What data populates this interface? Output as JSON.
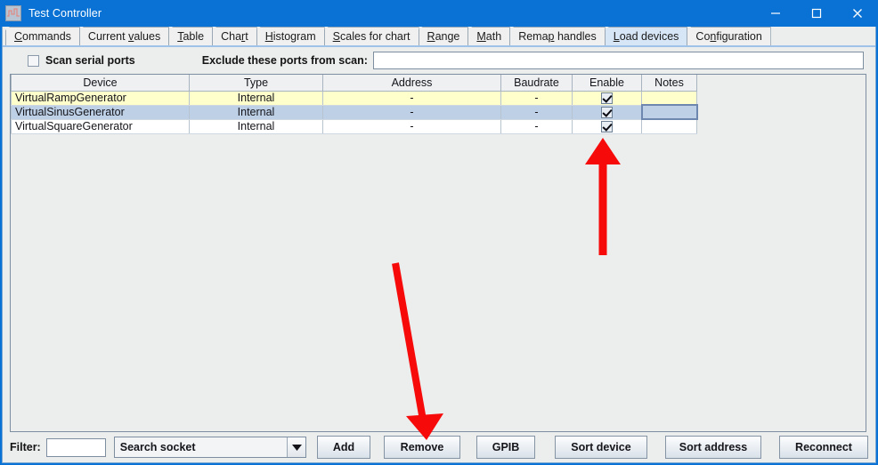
{
  "window": {
    "title": "Test Controller",
    "icon": "chart-waveform-icon",
    "minimize_label": "—",
    "maximize_label": "□",
    "close_label": "✕",
    "titlebar_color": "#0a72d4"
  },
  "tabs": [
    {
      "label": "Commands",
      "mnemonic_index": 0,
      "selected": false
    },
    {
      "label": "Current values",
      "mnemonic_index": 8,
      "selected": false
    },
    {
      "label": "Table",
      "mnemonic_index": 0,
      "selected": false
    },
    {
      "label": "Chart",
      "mnemonic_index": 3,
      "selected": false
    },
    {
      "label": "Histogram",
      "mnemonic_index": 0,
      "selected": false
    },
    {
      "label": "Scales for chart",
      "mnemonic_index": 0,
      "selected": false
    },
    {
      "label": "Range",
      "mnemonic_index": 0,
      "selected": false
    },
    {
      "label": "Math",
      "mnemonic_index": 0,
      "selected": false
    },
    {
      "label": "Remap handles",
      "mnemonic_index": 4,
      "selected": false
    },
    {
      "label": "Load devices",
      "mnemonic_index": 0,
      "selected": true
    },
    {
      "label": "Configuration",
      "mnemonic_index": 2,
      "selected": false
    }
  ],
  "options": {
    "scan_serial_ports_label": "Scan serial ports",
    "scan_serial_ports_checked": false,
    "exclude_label": "Exclude these ports from scan:",
    "exclude_value": "",
    "exclude_placeholder": ""
  },
  "table": {
    "columns": [
      "Device",
      "Type",
      "Address",
      "Baudrate",
      "Enable",
      "Notes"
    ],
    "rows": [
      {
        "device": "VirtualRampGenerator",
        "type": "Internal",
        "address": "-",
        "baudrate": "-",
        "enable": true,
        "notes": "",
        "state": "alternate"
      },
      {
        "device": "VirtualSinusGenerator",
        "type": "Internal",
        "address": "-",
        "baudrate": "-",
        "enable": true,
        "notes": "",
        "state": "selected"
      },
      {
        "device": "VirtualSquareGenerator",
        "type": "Internal",
        "address": "-",
        "baudrate": "-",
        "enable": true,
        "notes": "",
        "state": "normal"
      }
    ],
    "row_colors": {
      "alternate": "#ffffcc",
      "selected": "#bdd0e6",
      "normal": "#ffffff"
    }
  },
  "bottom": {
    "filter_label": "Filter:",
    "filter_value": "",
    "socket_selected": "Search socket",
    "socket_options": [
      "Search socket"
    ],
    "dropdown_icon": "chevron-down-icon",
    "buttons": {
      "add": "Add",
      "remove": "Remove",
      "gpib": "GPIB",
      "sort_device": "Sort device",
      "sort_address": "Sort address",
      "reconnect": "Reconnect"
    }
  },
  "annotations": {
    "color": "#f60a0a",
    "arrow_up_target": "enable-checkbox-row-3",
    "arrow_diagonal_target": "remove-button"
  }
}
